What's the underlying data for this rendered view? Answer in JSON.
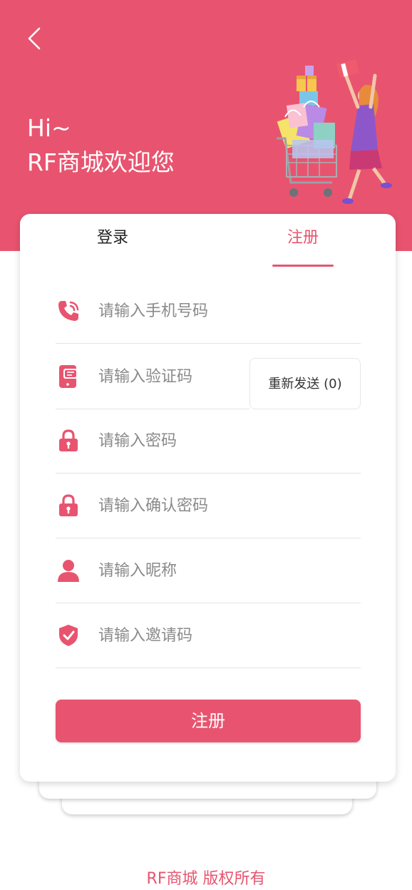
{
  "header": {
    "greeting": "Hi~",
    "welcome": "RF商城欢迎您"
  },
  "tabs": {
    "login": "登录",
    "register": "注册",
    "active": "register"
  },
  "form": {
    "phone_placeholder": "请输入手机号码",
    "code_placeholder": "请输入验证码",
    "resend_label": "重新发送 (0)",
    "password_placeholder": "请输入密码",
    "confirm_password_placeholder": "请输入确认密码",
    "nickname_placeholder": "请输入昵称",
    "invite_code_placeholder": "请输入邀请码",
    "submit_label": "注册"
  },
  "footer": {
    "copyright": "RF商城 版权所有"
  },
  "colors": {
    "brand": "#e8546f",
    "text": "#333333",
    "placeholder": "#8a8a8a"
  },
  "icons": {
    "back": "chevron-left-icon",
    "phone": "phone-icon",
    "code": "sms-phone-icon",
    "password": "lock-icon",
    "confirm_password": "lock-icon",
    "nickname": "user-icon",
    "invite_code": "shield-check-icon"
  }
}
